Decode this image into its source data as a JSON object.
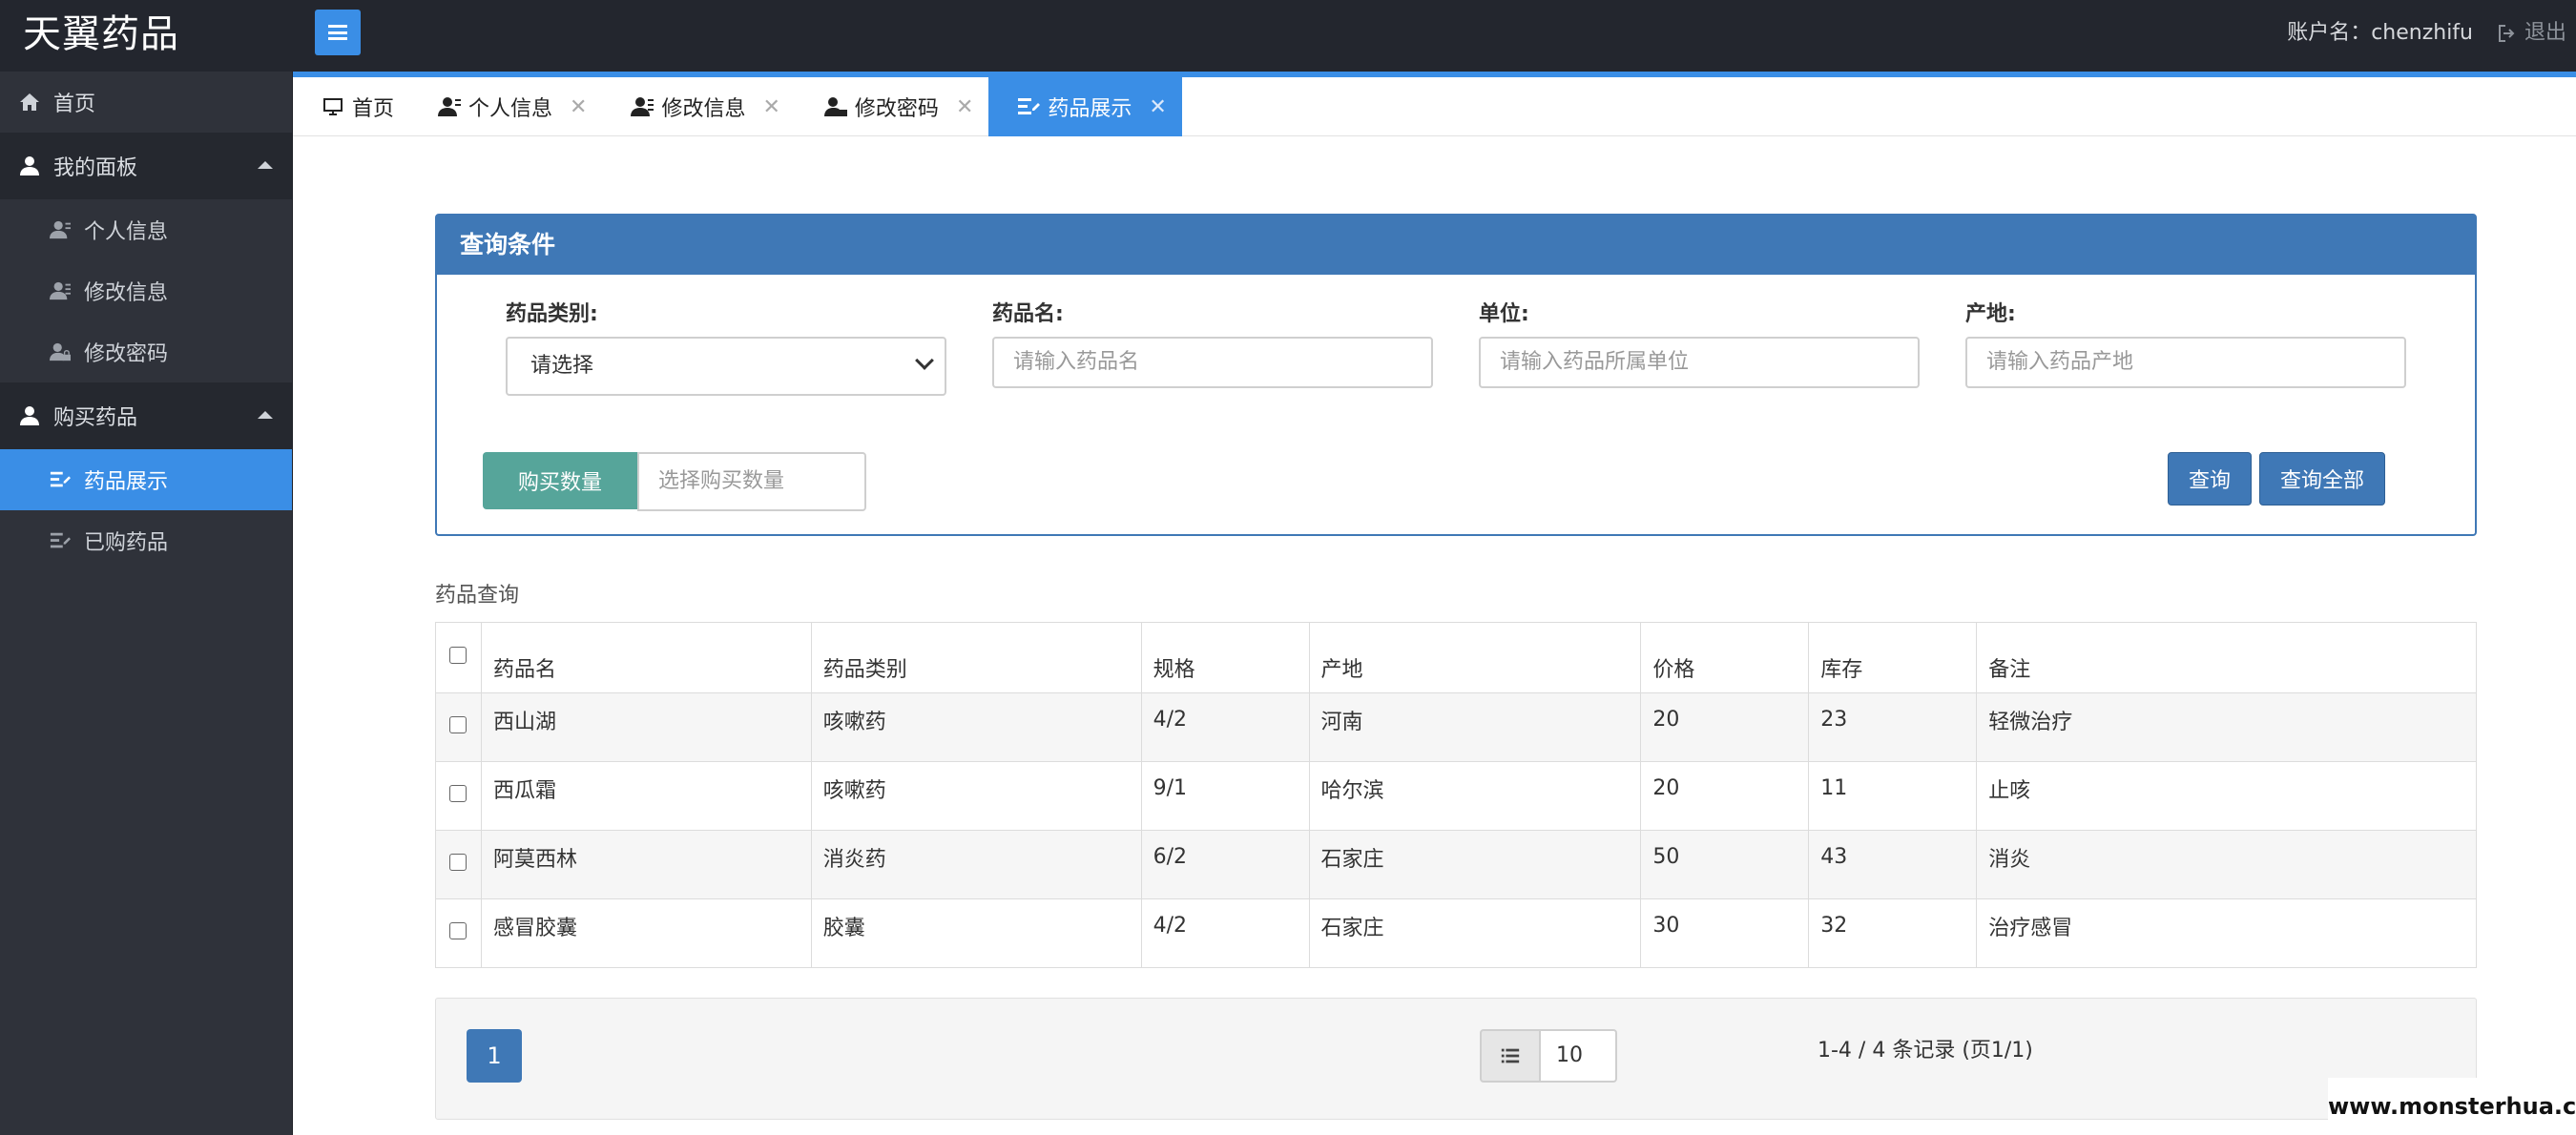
{
  "app": {
    "brand": "天翼药品",
    "account_label": "账户名：chenzhifu",
    "logout_label": "退出"
  },
  "sidebar": {
    "home": "首页",
    "groups": [
      {
        "label": "我的面板",
        "items": [
          "个人信息",
          "修改信息",
          "修改密码"
        ]
      },
      {
        "label": "购买药品",
        "items": [
          "药品展示",
          "已购药品"
        ]
      }
    ],
    "active": "药品展示"
  },
  "tabs": [
    "首页",
    "个人信息",
    "修改信息",
    "修改密码",
    "药品展示"
  ],
  "query": {
    "title": "查询条件",
    "category_label": "药品类别:",
    "category_value": "请选择",
    "name_label": "药品名:",
    "name_placeholder": "请输入药品名",
    "unit_label": "单位:",
    "unit_placeholder": "请输入药品所属单位",
    "origin_label": "产地:",
    "origin_placeholder": "请输入药品产地",
    "buy_qty_label": "购买数量",
    "buy_qty_placeholder": "选择购买数量",
    "search_button": "查询",
    "search_all_button": "查询全部"
  },
  "table": {
    "section_label": "药品查询",
    "headers": [
      "药品名",
      "药品类别",
      "规格",
      "产地",
      "价格",
      "库存",
      "备注"
    ],
    "rows": [
      [
        "西山湖",
        "咳嗽药",
        "4/2",
        "河南",
        "20",
        "23",
        "轻微治疗"
      ],
      [
        "西瓜霜",
        "咳嗽药",
        "9/1",
        "哈尔滨",
        "20",
        "11",
        "止咳"
      ],
      [
        "阿莫西林",
        "消炎药",
        "6/2",
        "石家庄",
        "50",
        "43",
        "消炎"
      ],
      [
        "感冒胶囊",
        "胶囊",
        "4/2",
        "石家庄",
        "30",
        "32",
        "治疗感冒"
      ]
    ]
  },
  "pagination": {
    "current_page": "1",
    "page_size": "10",
    "info": "1-4 / 4 条记录 (页1/1)"
  },
  "watermark": "www.monsterhua.com",
  "colors": {
    "accent": "#3a8ee6",
    "panel_blue": "#3f78b6",
    "buy_green": "#56a59a",
    "topbar": "#23262e",
    "sidebar": "#2f323a"
  }
}
